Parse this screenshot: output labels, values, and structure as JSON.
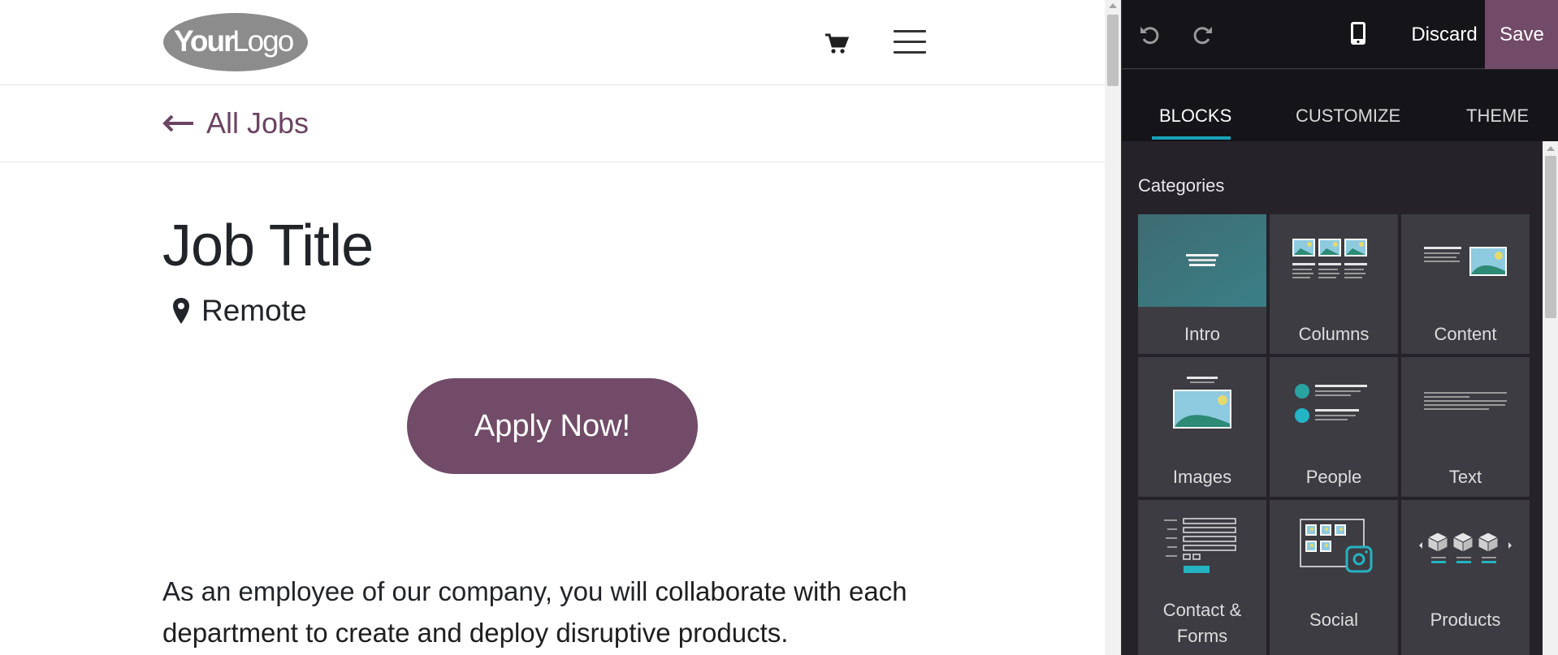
{
  "site": {
    "logo_text": "YourLogo",
    "nav": {
      "cart_icon": "shopping-cart-icon",
      "menu_icon": "hamburger-menu-icon"
    },
    "back_link": "All Jobs",
    "job_title": "Job Title",
    "location": "Remote",
    "apply_button": "Apply Now!",
    "description": {
      "text_light": "As an employee of our company, you will ",
      "text_bold": "collaborate with each department to create and deploy disruptive products."
    },
    "accent_color": "#714b67"
  },
  "editor": {
    "toolbar": {
      "undo_icon": "undo-icon",
      "redo_icon": "redo-icon",
      "mobile_icon": "mobile-preview-icon",
      "discard": "Discard",
      "save": "Save"
    },
    "tabs": [
      {
        "label": "BLOCKS",
        "active": true
      },
      {
        "label": "CUSTOMIZE",
        "active": false
      },
      {
        "label": "THEME",
        "active": false
      }
    ],
    "categories_label": "Categories",
    "blocks": [
      {
        "label": "Intro"
      },
      {
        "label": "Columns"
      },
      {
        "label": "Content"
      },
      {
        "label": "Images"
      },
      {
        "label": "People"
      },
      {
        "label": "Text"
      },
      {
        "label": "Contact & Forms"
      },
      {
        "label": "Social"
      },
      {
        "label": "Products"
      }
    ],
    "tab_accent_color": "#17a2b8"
  }
}
